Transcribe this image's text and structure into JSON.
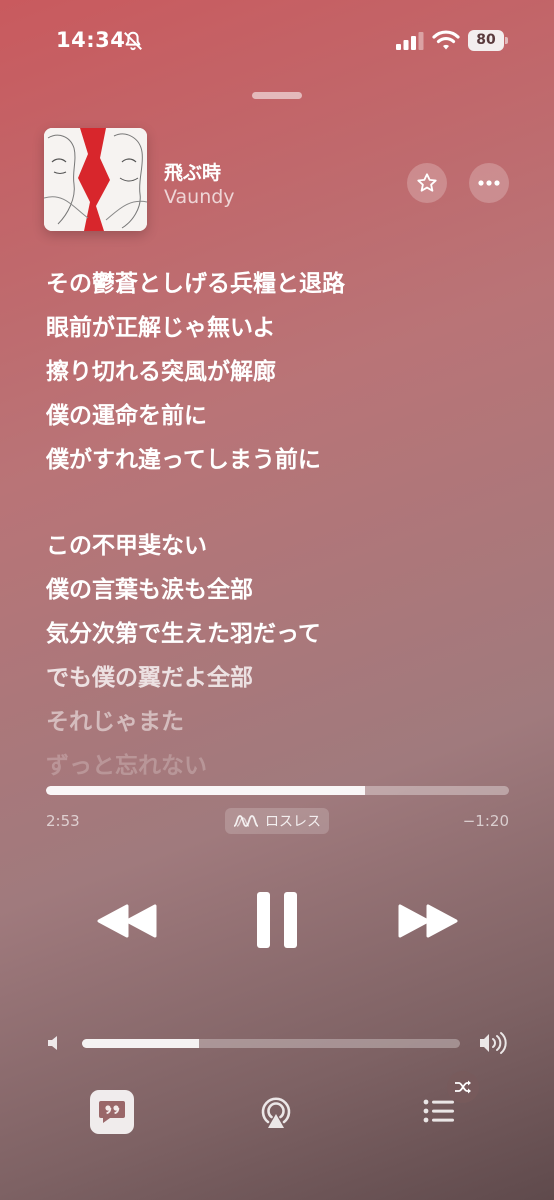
{
  "status_bar": {
    "time": "14:34",
    "battery": "80"
  },
  "now_playing": {
    "title": "飛ぶ時",
    "artist": "Vaundy"
  },
  "lyrics": {
    "stanza1": [
      "その鬱蒼としげる兵糧と退路",
      "眼前が正解じゃ無いよ",
      "擦り切れる突風が解廊",
      "僕の運命を前に",
      "僕がすれ違ってしまう前に"
    ],
    "stanza2": [
      "この不甲斐ない",
      "僕の言葉も涙も全部",
      "気分次第で生えた羽だって",
      "でも僕の翼だよ全部",
      "それじゃまた",
      "ずっと忘れない"
    ]
  },
  "playback": {
    "elapsed": "2:53",
    "remaining": "−1:20",
    "progress_fraction": 0.69,
    "quality_label": "ロスレス"
  },
  "volume": {
    "level_fraction": 0.31
  },
  "icons": {
    "bell": "bell-slash-icon",
    "signal": "cellular-signal-icon",
    "wifi": "wifi-icon",
    "favorite": "star-icon",
    "more": "ellipsis-icon",
    "rewind": "rewind-icon",
    "pause": "pause-icon",
    "forward": "fast-forward-icon",
    "lyrics": "quote-bubble-icon",
    "airplay": "airplay-icon",
    "queue": "list-icon",
    "shuffle": "shuffle-icon"
  },
  "colors": {
    "background_top": "#c95a5e",
    "background_bottom": "#5f4a4c"
  }
}
